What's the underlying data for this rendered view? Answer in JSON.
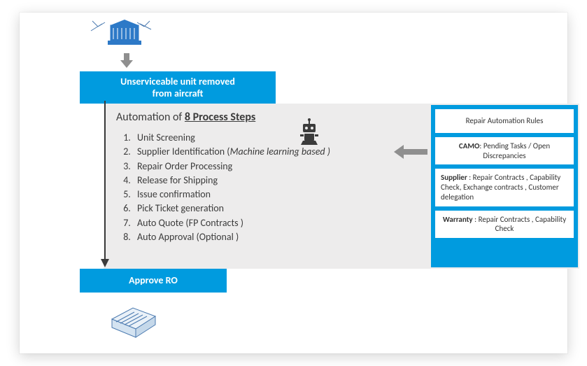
{
  "top_box": {
    "line1": "Unserviceable unit removed",
    "line2": "from aircraft"
  },
  "process": {
    "title_prefix": "Automation of ",
    "title_count": "8 Process Steps",
    "steps": [
      "Unit Screening",
      "Supplier Identification  (",
      "Repair Order Processing",
      "Release  for Shipping",
      "Issue confirmation",
      "Pick Ticket generation",
      "Auto Quote (FP Contracts )",
      "Auto Approval (Optional )"
    ],
    "ml_phrase": "Machine learning based )"
  },
  "bottom_box": {
    "label": "Approve RO"
  },
  "right": {
    "item1": "Repair Automation Rules",
    "item2_lead": "CAMO",
    "item2_rest": ": Pending Tasks / Open Discrepancies",
    "item3_lead": "Supplier",
    "item3_rest": "   : Repair Contracts , Capability Check, Exchange contracts , Customer delegation",
    "item4_lead": "Warranty",
    "item4_rest": "   : Repair Contracts , Capability Check"
  },
  "icons": {
    "facility_top": "facility-icon",
    "facility_bottom": "facility-icon",
    "robot": "robot-icon",
    "arrow_down": "arrow-down-icon",
    "arrow_left": "arrow-left-icon",
    "long_arrow": "arrow-down-long-icon"
  }
}
